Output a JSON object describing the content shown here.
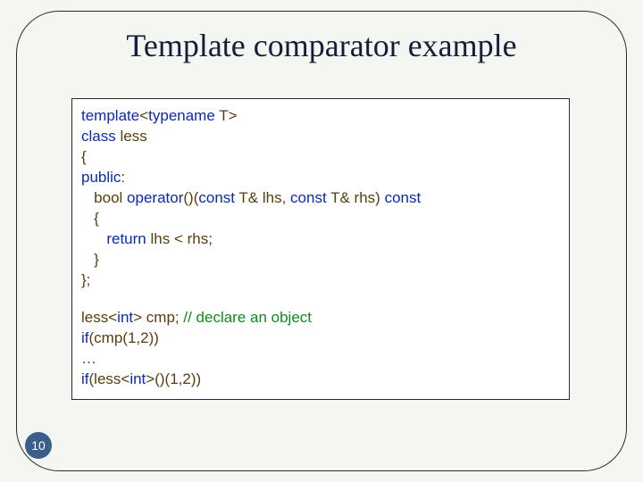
{
  "title": "Template comparator example",
  "page_number": "10",
  "code": {
    "l1_a": "template",
    "l1_b": "<",
    "l1_c": "typename",
    "l1_d": " T>",
    "l2_a": "class",
    "l2_b": " less",
    "l3": "{",
    "l4": "public",
    "l4b": ":",
    "l5_a": "   bool ",
    "l5_b": "operator",
    "l5_c": "()(",
    "l5_d": "const",
    "l5_e": " T& lhs, ",
    "l5_f": "const",
    "l5_g": " T& rhs) ",
    "l5_h": "const",
    "l6": "   {",
    "l7_a": "      ",
    "l7_b": "return",
    "l7_c": " lhs < rhs;",
    "l8": "   }",
    "l9": "};",
    "l10_a": "less<",
    "l10_b": "int",
    "l10_c": "> cmp; ",
    "l10_d": "// declare an object",
    "l11_a": "if",
    "l11_b": "(cmp(1,2))",
    "l12": "…",
    "l13_a": "if",
    "l13_b": "(less<",
    "l13_c": "int",
    "l13_d": ">()(1,2))"
  }
}
